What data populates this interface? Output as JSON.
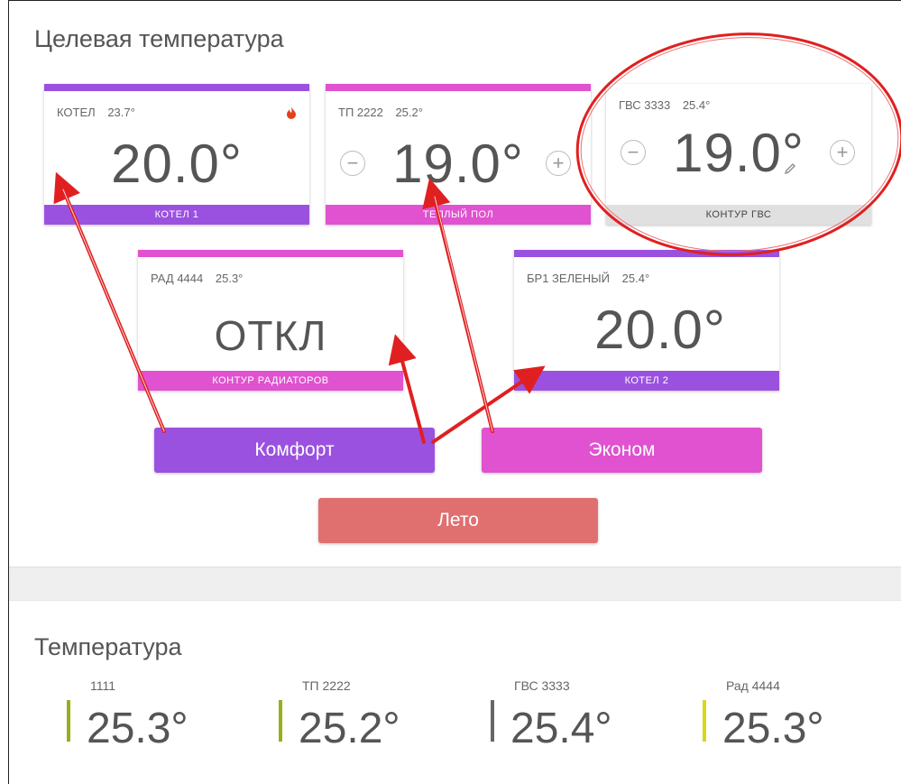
{
  "target": {
    "title": "Целевая температура",
    "cards": [
      {
        "name": "КОТЕЛ",
        "current": "23.7°",
        "target": "20.0°",
        "footer": "КОТЕЛ 1",
        "color": "#9b51e0",
        "icon": "flame-icon"
      },
      {
        "name": "ТП 2222",
        "current": "25.2°",
        "target": "19.0°",
        "footer": "ТЕПЛЫЙ ПОЛ",
        "color": "#e052d0"
      },
      {
        "name": "ГВС 3333",
        "current": "25.4°",
        "target": "19.0°",
        "footer": "КОНТУР ГВС",
        "color": "#e0e0e0",
        "icon": "pencil-icon"
      },
      {
        "name": "РАД 4444",
        "current": "25.3°",
        "target": "ОТКЛ",
        "footer": "КОНТУР РАДИАТОРОВ",
        "color": "#e052d0"
      },
      {
        "name": "БР1 ЗЕЛЕНЫЙ",
        "current": "25.4°",
        "target": "20.0°",
        "footer": "КОТЕЛ 2",
        "color": "#9b51e0"
      }
    ],
    "minus": "−",
    "plus": "+",
    "modes": {
      "comfort": "Комфорт",
      "econom": "Эконом",
      "summer": "Лето"
    },
    "colors": {
      "purple": "#9b51e0",
      "pink": "#e052d0",
      "red": "#e06f6f",
      "annotation": "#e02020"
    }
  },
  "temperature": {
    "title": "Температура",
    "sensors": [
      {
        "label": "1111",
        "value": "25.3°",
        "color": "#9aae1a"
      },
      {
        "label": "ТП 2222",
        "value": "25.2°",
        "color": "#9aae1a"
      },
      {
        "label": "ГВС 3333",
        "value": "25.4°",
        "color": "#666666"
      },
      {
        "label": "Рад 4444",
        "value": "25.3°",
        "color": "#d8d81a"
      }
    ]
  }
}
